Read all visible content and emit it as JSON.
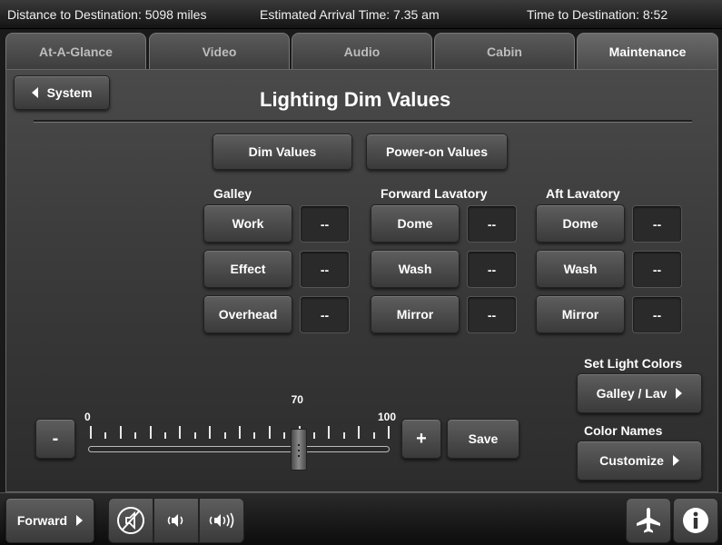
{
  "status_bar": {
    "distance": "Distance to Destination: 5098 miles",
    "arrival": "Estimated Arrival Time: 7.35 am",
    "time_to_dest": "Time to Destination: 8:52"
  },
  "tabs": [
    {
      "label": "At-A-Glance"
    },
    {
      "label": "Video"
    },
    {
      "label": "Audio"
    },
    {
      "label": "Cabin"
    },
    {
      "label": "Maintenance",
      "active": true
    }
  ],
  "header": {
    "back_label": "System",
    "title": "Lighting Dim Values"
  },
  "mode_buttons": {
    "dim": "Dim Values",
    "power_on": "Power-on Values"
  },
  "groups": [
    {
      "title": "Galley",
      "items": [
        {
          "label": "Work",
          "value": "--"
        },
        {
          "label": "Effect",
          "value": "--"
        },
        {
          "label": "Overhead",
          "value": "--"
        }
      ]
    },
    {
      "title": "Forward Lavatory",
      "items": [
        {
          "label": "Dome",
          "value": "--"
        },
        {
          "label": "Wash",
          "value": "--"
        },
        {
          "label": "Mirror",
          "value": "--"
        }
      ]
    },
    {
      "title": "Aft Lavatory",
      "items": [
        {
          "label": "Dome",
          "value": "--"
        },
        {
          "label": "Wash",
          "value": "--"
        },
        {
          "label": "Mirror",
          "value": "--"
        }
      ]
    }
  ],
  "slider": {
    "min_label": "0",
    "max_label": "100",
    "value_label": "70",
    "value": 70,
    "minus_label": "-",
    "plus_label": "+",
    "save_label": "Save"
  },
  "light_colors": {
    "set_title": "Set Light Colors",
    "set_button": "Galley / Lav",
    "names_title": "Color Names",
    "names_button": "Customize"
  },
  "bottom": {
    "zone_label": "Forward",
    "icons": [
      "mute-icon",
      "volume-low-icon",
      "volume-high-icon",
      "airplane-icon",
      "info-icon"
    ]
  },
  "colors": {
    "background": "#1a1a1a",
    "panel": "#3c3c3c",
    "button": "#4c4c4c",
    "text": "#ffffff"
  }
}
